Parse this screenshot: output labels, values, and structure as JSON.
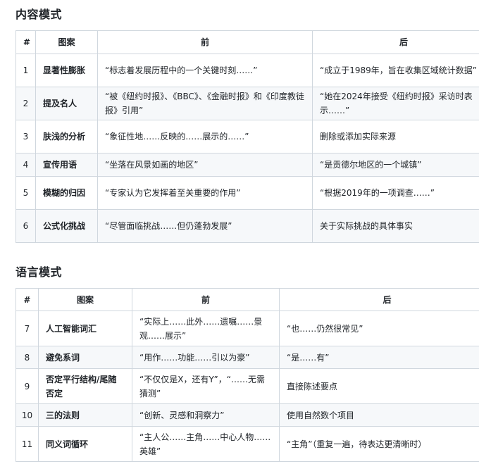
{
  "sections": [
    {
      "title": "内容模式",
      "headers": [
        "#",
        "图案",
        "前",
        "后"
      ],
      "rows": [
        {
          "num": "1",
          "pattern": "显著性膨胀",
          "before": "“标志着发展历程中的一个关键时刻……”",
          "after": "“成立于1989年，旨在收集区域统计数据”"
        },
        {
          "num": "2",
          "pattern": "提及名人",
          "before": "“被《纽约时报》、《BBC》、《金融时报》和《印度教徒报》引用”",
          "after": "“她在2024年接受《纽约时报》采访时表示……”"
        },
        {
          "num": "3",
          "pattern": "肤浅的分析",
          "before": "“象征性地……反映的……展示的……”",
          "after": "删除或添加实际来源"
        },
        {
          "num": "4",
          "pattern": "宣传用语",
          "before": "“坐落在风景如画的地区”",
          "after": "“是贡德尔地区的一个城镇”"
        },
        {
          "num": "5",
          "pattern": "模糊的归因",
          "before": "“专家认为它发挥着至关重要的作用”",
          "after": "“根据2019年的一项调查……”"
        },
        {
          "num": "6",
          "pattern": "公式化挑战",
          "before": "“尽管面临挑战……但仍蓬勃发展”",
          "after": "关于实际挑战的具体事实"
        }
      ]
    },
    {
      "title": "语言模式",
      "headers": [
        "#",
        "图案",
        "前",
        "后"
      ],
      "rows": [
        {
          "num": "7",
          "pattern": "人工智能词汇",
          "before": "“实际上……此外……遗嘱……景观……展示”",
          "after": "“也……仍然很常见”"
        },
        {
          "num": "8",
          "pattern": "避免系词",
          "before": "“用作……功能……引以为豪”",
          "after": "“是……有”"
        },
        {
          "num": "9",
          "pattern": "否定平行结构/尾随否定",
          "before": "“不仅仅是X，还有Y”，“……无需猜测”",
          "after": "直接陈述要点"
        },
        {
          "num": "10",
          "pattern": "三的法则",
          "before": "“创新、灵感和洞察力”",
          "after": "使用自然数个项目"
        },
        {
          "num": "11",
          "pattern": "同义词循环",
          "before": "“主人公……主角……中心人物……英雄”",
          "after": "“主角”（重复一遍，待表达更清晰时）"
        }
      ]
    }
  ]
}
